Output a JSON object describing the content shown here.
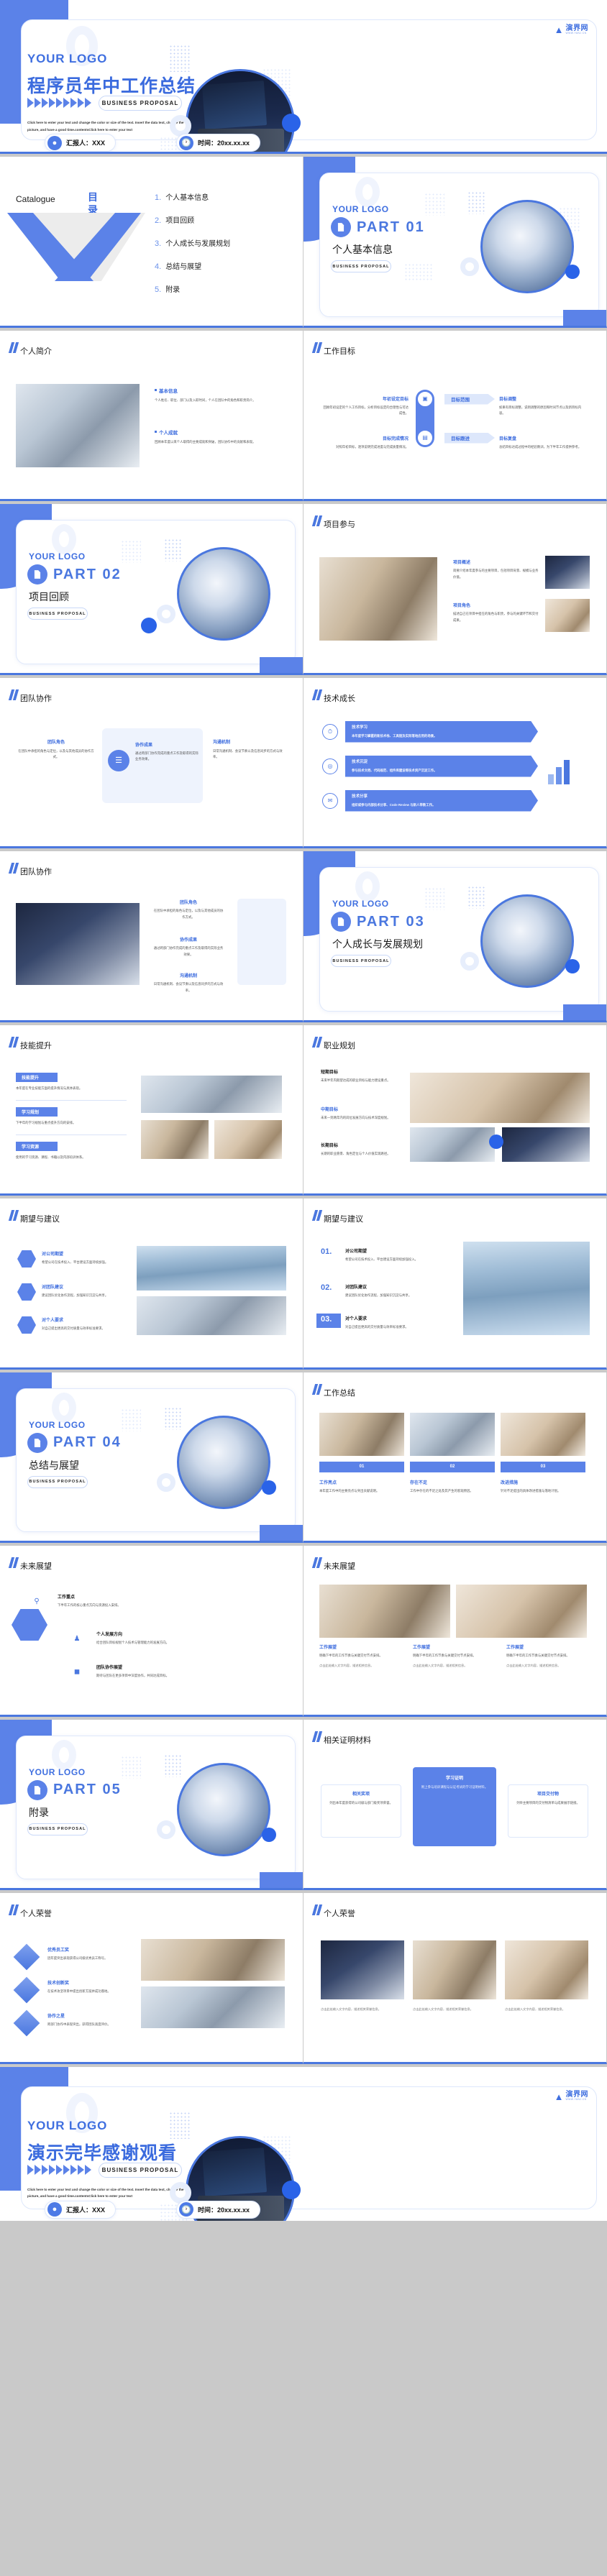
{
  "meta": {
    "brand_cn": "演界网",
    "brand_en": "WWW.YANJ.CN",
    "logo_text": "YOUR LOGO",
    "proposal_tag": "BUSINESS PROPOSAL",
    "accent": "#4a77df",
    "accent_light": "#5b82e8",
    "accent_pale": "#dde7fb",
    "text_dark": "#1a1a1a"
  },
  "cover": {
    "logo": "YOUR LOGO",
    "title": "程序员年中工作总结",
    "tag": "BUSINESS PROPOSAL",
    "desc": "Click here to enter your text and change the color or size of the text. Insert the data text, change the picture, and have a good time.contentsClick here to enter your text",
    "reporter_label": "汇报人：XXX",
    "date_label": "时间：20xx.xx.xx",
    "reporter_icon": "user-icon",
    "date_icon": "clock-icon"
  },
  "catalogue": {
    "label_en": "Catalogue",
    "label_cn": "目录",
    "items": [
      {
        "num": "1.",
        "text": "个人基本信息"
      },
      {
        "num": "2.",
        "text": "项目回顾"
      },
      {
        "num": "3.",
        "text": "个人成长与发展规划"
      },
      {
        "num": "4.",
        "text": "总结与展望"
      },
      {
        "num": "5.",
        "text": "附录"
      }
    ]
  },
  "parts": [
    {
      "logo": "YOUR LOGO",
      "num": "PART 01",
      "title": "个人基本信息",
      "tag": "BUSINESS PROPOSAL",
      "icon": "document-icon"
    },
    {
      "logo": "YOUR LOGO",
      "num": "PART 02",
      "title": "项目回顾",
      "tag": "BUSINESS PROPOSAL",
      "icon": "document-icon"
    },
    {
      "logo": "YOUR LOGO",
      "num": "PART 03",
      "title": "个人成长与发展规划",
      "tag": "BUSINESS PROPOSAL",
      "icon": "document-icon"
    },
    {
      "logo": "YOUR LOGO",
      "num": "PART 04",
      "title": "总结与展望",
      "tag": "BUSINESS PROPOSAL",
      "icon": "document-icon"
    },
    {
      "logo": "YOUR LOGO",
      "num": "PART 05",
      "title": "附录",
      "tag": "BUSINESS PROPOSAL",
      "icon": "document-icon"
    }
  ],
  "slides": {
    "profile": {
      "title": "个人简介",
      "blocks": [
        {
          "head": "基本信息",
          "body": "个人姓名、职位、部门以及入职时间，个人在团队中的角色和职责简介。"
        },
        {
          "head": "个人成就",
          "body": "回顾本年度以来个人取得的主要成就和突破，团队协作中的贡献和表现。"
        }
      ]
    },
    "goals": {
      "title": "工作目标",
      "cards": [
        {
          "head": "年初设定目标",
          "body": "回顾年初设定的个人工作目标，分析目标设定的合理性与可达成性。"
        },
        {
          "head": "目标调整",
          "body": "如果有目标调整，说明调整的原因和时间节点以及新目标内容。"
        },
        {
          "head": "目标完成情况",
          "body": "对照年初目标，逐项说明完成进度与完成质量情况。"
        },
        {
          "head": "目标复盘",
          "body": "总结目标达成过程中的经验教训，为下半年工作提供参考。"
        }
      ],
      "right_labels": [
        "目标范围",
        "目标跟进"
      ]
    },
    "project_part": {
      "title": "项目参与",
      "blocks": [
        {
          "head": "项目概述",
          "body": "简要介绍本年度参与的主要项目，包括项目背景、规模与业务价值。"
        },
        {
          "head": "项目角色",
          "body": "描述自己在项目中担任的角色与职责，参与的关键环节和交付成果。"
        }
      ]
    },
    "teamwork": {
      "title": "团队协作",
      "blocks": [
        {
          "head": "团队角色",
          "body": "在团队中承担的角色与定位，以及与其他成员的协作方式。"
        },
        {
          "head": "协作成果",
          "body": "通过跨部门协作完成的重点工作及取得的实际业务效果。"
        },
        {
          "head": "沟通机制",
          "body": "日常沟通机制、会议节奏以及信息同步的方式与效率。"
        }
      ]
    },
    "skills": {
      "title": "技术成长",
      "rows": [
        {
          "head": "技术学习",
          "body": "本年度学习掌握的新技术栈、工具链及实际落地应用的场景。"
        },
        {
          "head": "技术沉淀",
          "body": "参与技术文档、代码规范、组件库建设等技术资产沉淀工作。"
        },
        {
          "head": "技术分享",
          "body": "组织或参与内部技术分享、Code Review 与新人带教工作。"
        }
      ]
    },
    "teamwork2": {
      "title": "团队协作",
      "blocks": [
        {
          "head": "团队角色",
          "body": "在团队中承担的角色与定位，以及与其他成员的协作方式。"
        },
        {
          "head": "协作成果",
          "body": "通过跨部门协作完成的重点工作及取得的实际业务效果。"
        },
        {
          "head": "沟通机制",
          "body": "日常沟通机制、会议节奏以及信息同步的方式与效率。"
        }
      ]
    },
    "ability": {
      "title": "技能提升",
      "blocks": [
        {
          "head": "技能提升",
          "body": "本年度在专业技能方面的提升情况与具体表现。"
        },
        {
          "head": "学习规划",
          "body": "下半年的学习规划与重点提升方向的安排。"
        },
        {
          "head": "学习资源",
          "body": "使用的学习资源、课程、书籍以及内部培训体系。"
        }
      ]
    },
    "career": {
      "title": "职业规划",
      "blocks": [
        {
          "head": "短期目标",
          "body": "未来半年内期望达成的职业目标与能力建设重点。"
        },
        {
          "head": "中期目标",
          "body": "未来一到两年内的岗位发展方向与技术深度规划。"
        },
        {
          "head": "长期目标",
          "body": "长期的职业愿景、角色定位与个人价值实现路径。"
        }
      ]
    },
    "suggest1": {
      "title": "期望与建议",
      "blocks": [
        {
          "head": "对公司期望",
          "body": "希望公司在技术投入、平台建设方面持续加强。"
        },
        {
          "head": "对团队建议",
          "body": "建议团队优化协作流程，加强知识沉淀与共享。"
        },
        {
          "head": "对个人要求",
          "body": "对自己提出更高的交付质量与效率标准要求。"
        }
      ]
    },
    "suggest2": {
      "title": "期望与建议",
      "items": [
        {
          "num": "01.",
          "head": "对公司期望",
          "body": "希望公司在技术投入、平台建设方面持续加强投入。"
        },
        {
          "num": "02.",
          "head": "对团队建议",
          "body": "建议团队优化协作流程，加强知识沉淀与共享。"
        },
        {
          "num": "03.",
          "head": "对个人要求",
          "body": "对自己提出更高的交付质量与效率标准要求。"
        }
      ]
    },
    "work_summary": {
      "title": "工作总结",
      "items": [
        {
          "num": "01",
          "head": "工作亮点",
          "body": "本年度工作中的主要亮点与突出贡献说明。"
        },
        {
          "num": "02",
          "head": "存在不足",
          "body": "工作中存在的不足之处及其产生的客观原因。"
        },
        {
          "num": "03",
          "head": "改进措施",
          "body": "针对不足提出的具体改进措施与落地计划。"
        }
      ]
    },
    "future1": {
      "title": "未来展望",
      "blocks": [
        {
          "head": "工作重点",
          "body": "下半年工作的核心重点方向与资源投入安排。"
        },
        {
          "head": "个人发展方向",
          "body": "结合团队目标规划个人技术与管理能力的发展方向。"
        },
        {
          "head": "团队协作展望",
          "body": "期待与团队在更多项目中深度协作，共同达成目标。"
        }
      ]
    },
    "future2": {
      "title": "未来展望",
      "columns": [
        {
          "head": "工作展望",
          "body": "明确下半年的工作节奏与关键交付节点安排。",
          "sub": "点击此处输入文字内容，描述相关信息。"
        },
        {
          "head": "工作展望",
          "body": "明确下半年的工作节奏与关键交付节点安排。",
          "sub": "点击此处输入文字内容，描述相关信息。"
        },
        {
          "head": "工作展望",
          "body": "明确下半年的工作节奏与关键交付节点安排。",
          "sub": "点击此处输入文字内容，描述相关信息。"
        }
      ]
    },
    "appendix": {
      "title": "相关证明材料",
      "cards": [
        {
          "head": "相关奖项",
          "body": "列出本年度获得的公司级与部门级奖项荣誉。"
        },
        {
          "head": "学习证明",
          "body": "附上参与培训课程与认证考试的学习证明材料。"
        },
        {
          "head": "项目交付物",
          "body": "列举主要项目的交付物清单与成果展示链接。"
        }
      ]
    },
    "honor1": {
      "title": "个人荣誉",
      "blocks": [
        {
          "head": "优秀员工奖",
          "body": "因年度突出表现获得公司级优秀员工称号。"
        },
        {
          "head": "技术创新奖",
          "body": "在技术攻坚项目中提出创新方案并成功落地。"
        },
        {
          "head": "协作之星",
          "body": "跨部门协作中表现突出，获得团队高度评价。"
        }
      ]
    },
    "honor2": {
      "title": "个人荣誉",
      "captions": [
        "点击此处输入文字内容，描述相关荣誉信息。",
        "点击此处输入文字内容，描述相关荣誉信息。",
        "点击此处输入文字内容，描述相关荣誉信息。"
      ]
    }
  },
  "end": {
    "logo": "YOUR LOGO",
    "title": "演示完毕感谢观看",
    "tag": "BUSINESS PROPOSAL",
    "desc": "Click here to enter your text and change the color or size of the text. Insert the data text, change the picture, and have a good time.contentsClick here to enter your text",
    "reporter_label": "汇报人：XXX",
    "date_label": "时间：20xx.xx.xx"
  }
}
